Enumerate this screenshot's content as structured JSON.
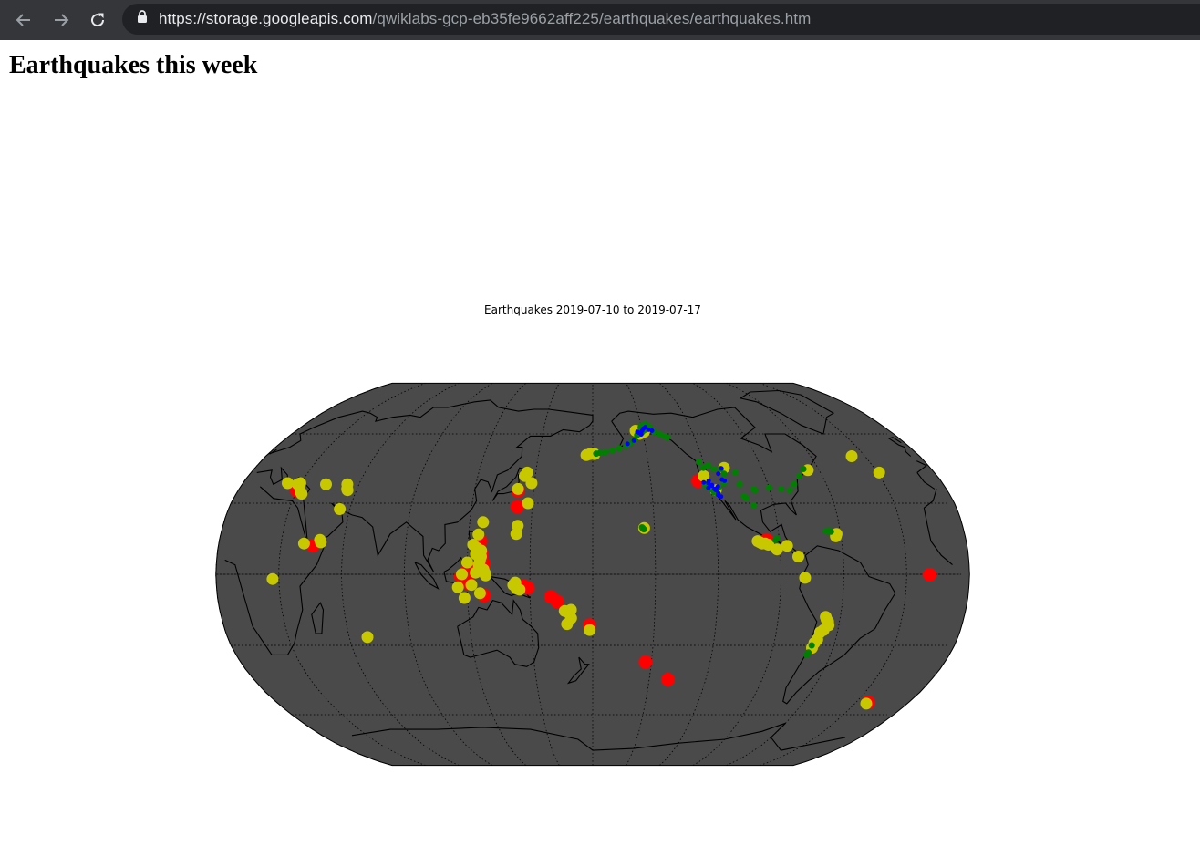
{
  "browser": {
    "url_host": "https://storage.googleapis.com",
    "url_path": "/qwiklabs-gcp-eb35fe9662aff225/earthquakes/earthquakes.htm",
    "back_icon": "arrow-left-icon",
    "forward_icon": "arrow-right-icon",
    "reload_icon": "reload-icon",
    "lock_icon": "lock-icon"
  },
  "page": {
    "heading": "Earthquakes this week"
  },
  "colors": {
    "browser_bar": "#35363a",
    "url_box": "#202124",
    "ocean": "#4a4a4a",
    "land": "#4a4a4a",
    "coast": "#000000",
    "large_quake": "#ff0000",
    "medium_quake": "#c8c800",
    "small_quake": "#008000",
    "tiny_quake": "#0000ff"
  },
  "chart_data": {
    "type": "scatter",
    "title": "Earthquakes 2019-07-10 to 2019-07-17",
    "projection": "robinson",
    "grid": true,
    "xlabel": "",
    "ylabel": "",
    "xlim": [
      -180,
      180
    ],
    "ylim": [
      -90,
      90
    ],
    "series": [
      {
        "color": "red",
        "size": "large",
        "points": [
          [
            142.2,
            35.3
          ],
          [
            142.7,
            28.5
          ],
          [
            126.0,
            14.0
          ],
          [
            126.9,
            8.5
          ],
          [
            128.0,
            4.4
          ],
          [
            122.5,
            2.5
          ],
          [
            119.5,
            0.9
          ],
          [
            117.0,
            -1.0
          ],
          [
            121.0,
            -4.0
          ],
          [
            147.0,
            -5.0
          ],
          [
            149.0,
            -5.8
          ],
          [
            160.0,
            -9.5
          ],
          [
            163.0,
            -11.5
          ],
          [
            128.0,
            -9.0
          ],
          [
            178.5,
            -21.5
          ],
          [
            -153.0,
            -37.0
          ],
          [
            -140.0,
            -44.5
          ],
          [
            -125.5,
            39.4
          ],
          [
            -96.0,
            14.5
          ],
          [
            -19.0,
            -0.2
          ],
          [
            30.0,
            35.2
          ],
          [
            45.5,
            12.0
          ],
          [
            -23.0,
            -54.5
          ],
          [
            126.2,
            4.0
          ]
        ]
      },
      {
        "color": "yellow",
        "size": "medium",
        "points": [
          [
            176.5,
            50.5
          ],
          [
            178.5,
            51.0
          ],
          [
            -179.0,
            51.0
          ],
          [
            -152.0,
            60.0
          ],
          [
            -154.0,
            61.5
          ],
          [
            -149.0,
            61.0
          ],
          [
            144.5,
            41.5
          ],
          [
            145.5,
            43.0
          ],
          [
            142.0,
            36.0
          ],
          [
            148.5,
            38.5
          ],
          [
            147.8,
            30.0
          ],
          [
            143.5,
            20.5
          ],
          [
            143.0,
            17.0
          ],
          [
            126.5,
            22.0
          ],
          [
            124.7,
            16.8
          ],
          [
            122.5,
            12.5
          ],
          [
            124.5,
            11.0
          ],
          [
            126.5,
            7.5
          ],
          [
            126.0,
            5.8
          ],
          [
            125.5,
            4.0
          ],
          [
            127.8,
            2.0
          ],
          [
            128.5,
            0.5
          ],
          [
            117.5,
            0.0
          ],
          [
            115.5,
            -5.5
          ],
          [
            122.0,
            -4.5
          ],
          [
            120.0,
            5.0
          ],
          [
            124.0,
            8.5
          ],
          [
            126.5,
            10.0
          ],
          [
            124.0,
            0.7
          ],
          [
            128.8,
            -0.5
          ],
          [
            126.0,
            -8.0
          ],
          [
            118.5,
            -10.0
          ],
          [
            142.0,
            -4.5
          ],
          [
            143.0,
            -3.5
          ],
          [
            143.5,
            -6.0
          ],
          [
            145.0,
            -6.5
          ],
          [
            166.5,
            -15.5
          ],
          [
            168.0,
            -16.0
          ],
          [
            169.5,
            -15.0
          ],
          [
            169.5,
            -18.5
          ],
          [
            167.5,
            -21.0
          ],
          [
            178.5,
            -23.5
          ],
          [
            -100.5,
            14.0
          ],
          [
            -99.5,
            13.5
          ],
          [
            -98.5,
            13.0
          ],
          [
            -97.0,
            13.0
          ],
          [
            -95.5,
            12.5
          ],
          [
            -91.5,
            10.5
          ],
          [
            -86.5,
            12.0
          ],
          [
            -81.5,
            7.5
          ],
          [
            -78.5,
            -1.5
          ],
          [
            -67.0,
            -18.0
          ],
          [
            -66.5,
            -19.0
          ],
          [
            -65.5,
            -20.0
          ],
          [
            -65.0,
            -21.5
          ],
          [
            -67.0,
            -23.5
          ],
          [
            -68.5,
            -24.5
          ],
          [
            -69.0,
            -27.5
          ],
          [
            -70.0,
            -29.0
          ],
          [
            -70.5,
            -31.0
          ],
          [
            -66.0,
            44.0
          ],
          [
            -37.5,
            50.0
          ],
          [
            -29.0,
            43.0
          ],
          [
            28.5,
            38.0
          ],
          [
            29.5,
            38.5
          ],
          [
            32.5,
            34.5
          ],
          [
            33.0,
            34.0
          ],
          [
            43.0,
            38.0
          ],
          [
            54.0,
            38.0
          ],
          [
            55.0,
            36.0
          ],
          [
            55.5,
            35.5
          ],
          [
            55.0,
            27.5
          ],
          [
            41.0,
            13.0
          ],
          [
            48.5,
            14.5
          ],
          [
            49.0,
            13.5
          ],
          [
            27.0,
            -2.0
          ],
          [
            69.0,
            -26.5
          ],
          [
            -23.5,
            -55.0
          ],
          [
            23.0,
            38.5
          ],
          [
            -155.0,
            19.5
          ],
          [
            -117.5,
            35.5
          ],
          [
            -122.0,
            41.5
          ],
          [
            -110.0,
            45.0
          ],
          [
            -62.0,
            17.0
          ],
          [
            -62.5,
            16.0
          ]
        ]
      },
      {
        "color": "green",
        "size": "small",
        "points": [
          [
            -155.5,
            19.3
          ],
          [
            -155.2,
            19.0
          ],
          [
            -156.0,
            19.8
          ],
          [
            -155.8,
            19.6
          ],
          [
            -148.0,
            62.0
          ],
          [
            -150.0,
            61.0
          ],
          [
            -151.5,
            60.2
          ],
          [
            -150.5,
            63.0
          ],
          [
            -149.5,
            64.0
          ],
          [
            -147.0,
            64.5
          ],
          [
            -145.0,
            63.5
          ],
          [
            -143.0,
            61.0
          ],
          [
            -140.0,
            60.0
          ],
          [
            -138.0,
            59.0
          ],
          [
            -136.0,
            58.5
          ],
          [
            -153.5,
            59.5
          ],
          [
            -155.5,
            57.5
          ],
          [
            -158.0,
            56.0
          ],
          [
            -161.0,
            54.5
          ],
          [
            -165.0,
            53.5
          ],
          [
            -169.0,
            52.5
          ],
          [
            -173.0,
            51.8
          ],
          [
            -176.0,
            51.5
          ],
          [
            -178.0,
            51.2
          ],
          [
            -121.0,
            45.0
          ],
          [
            -122.5,
            47.5
          ],
          [
            -118.0,
            46.0
          ],
          [
            -115.5,
            44.5
          ],
          [
            -112.0,
            44.5
          ],
          [
            -111.0,
            42.5
          ],
          [
            -112.5,
            38.5
          ],
          [
            -116.0,
            36.5
          ],
          [
            -117.0,
            34.0
          ],
          [
            -118.5,
            34.5
          ],
          [
            -119.5,
            35.8
          ],
          [
            -121.5,
            37.0
          ],
          [
            -122.5,
            38.0
          ],
          [
            -104.5,
            38.0
          ],
          [
            -98.0,
            36.0
          ],
          [
            -97.5,
            35.5
          ],
          [
            -90.0,
            36.5
          ],
          [
            -84.0,
            36.0
          ],
          [
            -80.0,
            35.5
          ],
          [
            -76.5,
            38.0
          ],
          [
            -72.0,
            41.5
          ],
          [
            -68.0,
            44.5
          ],
          [
            -105.0,
            43.0
          ],
          [
            -66.0,
            18.0
          ],
          [
            -65.5,
            18.5
          ],
          [
            -67.0,
            18.2
          ],
          [
            -64.5,
            18.0
          ],
          [
            -91.0,
            15.0
          ],
          [
            -92.0,
            14.5
          ],
          [
            -71.0,
            -30.0
          ],
          [
            -71.5,
            -33.0
          ],
          [
            -72.0,
            -34.0
          ],
          [
            -104.0,
            33.0
          ],
          [
            -103.0,
            32.0
          ],
          [
            -100.0,
            29.0
          ],
          [
            -66.5,
            18.3
          ]
        ]
      },
      {
        "color": "blue",
        "size": "tiny",
        "points": [
          [
            -150.0,
            61.5
          ],
          [
            -149.0,
            62.5
          ],
          [
            -147.5,
            63.2
          ],
          [
            -152.0,
            60.5
          ],
          [
            -151.0,
            59.8
          ],
          [
            -146.0,
            62.0
          ],
          [
            -144.0,
            61.5
          ],
          [
            -153.0,
            61.0
          ],
          [
            -117.5,
            35.7
          ],
          [
            -117.6,
            35.8
          ],
          [
            -117.4,
            35.6
          ],
          [
            -117.7,
            35.9
          ],
          [
            -117.3,
            35.5
          ],
          [
            -118.0,
            36.0
          ],
          [
            -116.5,
            34.2
          ],
          [
            -116.8,
            33.5
          ],
          [
            -119.0,
            37.5
          ],
          [
            -120.5,
            38.5
          ],
          [
            -121.0,
            36.5
          ],
          [
            -122.8,
            38.8
          ],
          [
            -115.5,
            32.8
          ],
          [
            -111.5,
            44.7
          ],
          [
            -114.0,
            42.5
          ],
          [
            -113.0,
            40.0
          ],
          [
            -111.8,
            39.5
          ],
          [
            -118.8,
            37.6
          ],
          [
            -116.0,
            37.0
          ],
          [
            -120.0,
            39.5
          ],
          [
            -156.0,
            57.0
          ],
          [
            -160.0,
            55.5
          ]
        ]
      }
    ]
  }
}
